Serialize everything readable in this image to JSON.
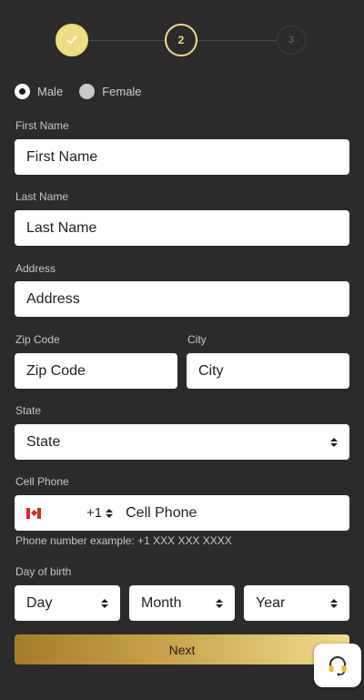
{
  "stepper": {
    "steps": [
      {
        "label": "",
        "state": "done"
      },
      {
        "label": "2",
        "state": "active"
      },
      {
        "label": "3",
        "state": "upcoming"
      }
    ],
    "accent": "#f1dc86"
  },
  "gender": {
    "options": [
      {
        "label": "Male",
        "selected": true
      },
      {
        "label": "Female",
        "selected": false
      }
    ]
  },
  "form": {
    "first_name": {
      "label": "First Name",
      "placeholder": "First Name"
    },
    "last_name": {
      "label": "Last Name",
      "placeholder": "Last Name"
    },
    "address": {
      "label": "Address",
      "placeholder": "Address"
    },
    "zip": {
      "label": "Zip Code",
      "placeholder": "Zip Code"
    },
    "city": {
      "label": "City",
      "placeholder": "City"
    },
    "state": {
      "label": "State",
      "value": "State"
    },
    "phone": {
      "label": "Cell Phone",
      "country": "CA",
      "dial_code": "+1",
      "placeholder": "Cell Phone",
      "hint": "Phone number example: +1 XXX XXX XXXX"
    },
    "dob": {
      "label": "Day of birth",
      "day": "Day",
      "month": "Month",
      "year": "Year"
    }
  },
  "actions": {
    "next_label": "Next"
  },
  "support": {
    "icon": "headset-icon"
  }
}
